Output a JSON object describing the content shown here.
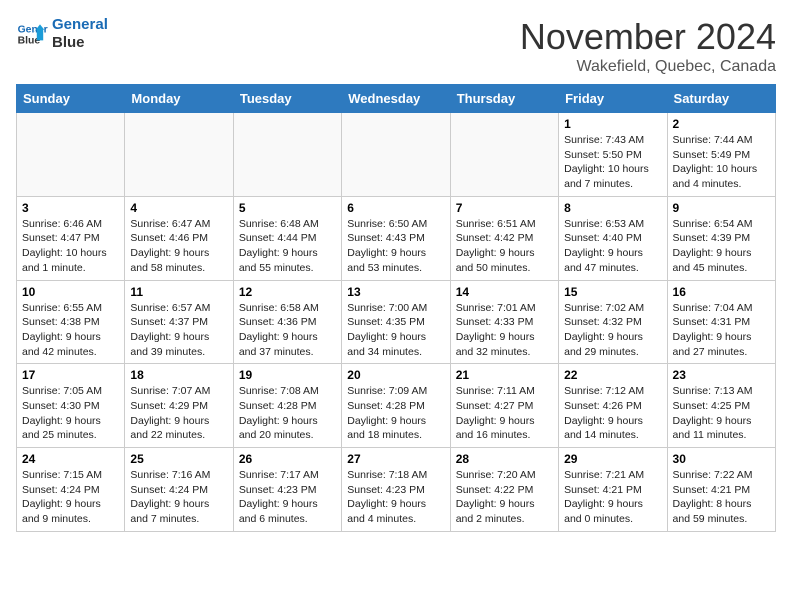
{
  "logo": {
    "line1": "General",
    "line2": "Blue"
  },
  "title": "November 2024",
  "location": "Wakefield, Quebec, Canada",
  "days_of_week": [
    "Sunday",
    "Monday",
    "Tuesday",
    "Wednesday",
    "Thursday",
    "Friday",
    "Saturday"
  ],
  "weeks": [
    [
      {
        "day": "",
        "text": ""
      },
      {
        "day": "",
        "text": ""
      },
      {
        "day": "",
        "text": ""
      },
      {
        "day": "",
        "text": ""
      },
      {
        "day": "",
        "text": ""
      },
      {
        "day": "1",
        "text": "Sunrise: 7:43 AM\nSunset: 5:50 PM\nDaylight: 10 hours and 7 minutes."
      },
      {
        "day": "2",
        "text": "Sunrise: 7:44 AM\nSunset: 5:49 PM\nDaylight: 10 hours and 4 minutes."
      }
    ],
    [
      {
        "day": "3",
        "text": "Sunrise: 6:46 AM\nSunset: 4:47 PM\nDaylight: 10 hours and 1 minute."
      },
      {
        "day": "4",
        "text": "Sunrise: 6:47 AM\nSunset: 4:46 PM\nDaylight: 9 hours and 58 minutes."
      },
      {
        "day": "5",
        "text": "Sunrise: 6:48 AM\nSunset: 4:44 PM\nDaylight: 9 hours and 55 minutes."
      },
      {
        "day": "6",
        "text": "Sunrise: 6:50 AM\nSunset: 4:43 PM\nDaylight: 9 hours and 53 minutes."
      },
      {
        "day": "7",
        "text": "Sunrise: 6:51 AM\nSunset: 4:42 PM\nDaylight: 9 hours and 50 minutes."
      },
      {
        "day": "8",
        "text": "Sunrise: 6:53 AM\nSunset: 4:40 PM\nDaylight: 9 hours and 47 minutes."
      },
      {
        "day": "9",
        "text": "Sunrise: 6:54 AM\nSunset: 4:39 PM\nDaylight: 9 hours and 45 minutes."
      }
    ],
    [
      {
        "day": "10",
        "text": "Sunrise: 6:55 AM\nSunset: 4:38 PM\nDaylight: 9 hours and 42 minutes."
      },
      {
        "day": "11",
        "text": "Sunrise: 6:57 AM\nSunset: 4:37 PM\nDaylight: 9 hours and 39 minutes."
      },
      {
        "day": "12",
        "text": "Sunrise: 6:58 AM\nSunset: 4:36 PM\nDaylight: 9 hours and 37 minutes."
      },
      {
        "day": "13",
        "text": "Sunrise: 7:00 AM\nSunset: 4:35 PM\nDaylight: 9 hours and 34 minutes."
      },
      {
        "day": "14",
        "text": "Sunrise: 7:01 AM\nSunset: 4:33 PM\nDaylight: 9 hours and 32 minutes."
      },
      {
        "day": "15",
        "text": "Sunrise: 7:02 AM\nSunset: 4:32 PM\nDaylight: 9 hours and 29 minutes."
      },
      {
        "day": "16",
        "text": "Sunrise: 7:04 AM\nSunset: 4:31 PM\nDaylight: 9 hours and 27 minutes."
      }
    ],
    [
      {
        "day": "17",
        "text": "Sunrise: 7:05 AM\nSunset: 4:30 PM\nDaylight: 9 hours and 25 minutes."
      },
      {
        "day": "18",
        "text": "Sunrise: 7:07 AM\nSunset: 4:29 PM\nDaylight: 9 hours and 22 minutes."
      },
      {
        "day": "19",
        "text": "Sunrise: 7:08 AM\nSunset: 4:28 PM\nDaylight: 9 hours and 20 minutes."
      },
      {
        "day": "20",
        "text": "Sunrise: 7:09 AM\nSunset: 4:28 PM\nDaylight: 9 hours and 18 minutes."
      },
      {
        "day": "21",
        "text": "Sunrise: 7:11 AM\nSunset: 4:27 PM\nDaylight: 9 hours and 16 minutes."
      },
      {
        "day": "22",
        "text": "Sunrise: 7:12 AM\nSunset: 4:26 PM\nDaylight: 9 hours and 14 minutes."
      },
      {
        "day": "23",
        "text": "Sunrise: 7:13 AM\nSunset: 4:25 PM\nDaylight: 9 hours and 11 minutes."
      }
    ],
    [
      {
        "day": "24",
        "text": "Sunrise: 7:15 AM\nSunset: 4:24 PM\nDaylight: 9 hours and 9 minutes."
      },
      {
        "day": "25",
        "text": "Sunrise: 7:16 AM\nSunset: 4:24 PM\nDaylight: 9 hours and 7 minutes."
      },
      {
        "day": "26",
        "text": "Sunrise: 7:17 AM\nSunset: 4:23 PM\nDaylight: 9 hours and 6 minutes."
      },
      {
        "day": "27",
        "text": "Sunrise: 7:18 AM\nSunset: 4:23 PM\nDaylight: 9 hours and 4 minutes."
      },
      {
        "day": "28",
        "text": "Sunrise: 7:20 AM\nSunset: 4:22 PM\nDaylight: 9 hours and 2 minutes."
      },
      {
        "day": "29",
        "text": "Sunrise: 7:21 AM\nSunset: 4:21 PM\nDaylight: 9 hours and 0 minutes."
      },
      {
        "day": "30",
        "text": "Sunrise: 7:22 AM\nSunset: 4:21 PM\nDaylight: 8 hours and 59 minutes."
      }
    ]
  ]
}
